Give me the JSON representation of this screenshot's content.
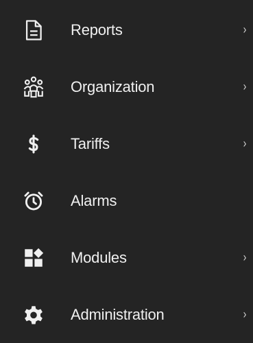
{
  "menu": {
    "items": [
      {
        "label": "Reports",
        "icon": "document-icon",
        "chevron": "›"
      },
      {
        "label": "Organization",
        "icon": "people-network-icon",
        "chevron": "›"
      },
      {
        "label": "Tariffs",
        "icon": "dollar-icon",
        "chevron": "›"
      },
      {
        "label": "Alarms",
        "icon": "alarm-clock-icon",
        "chevron": ""
      },
      {
        "label": "Modules",
        "icon": "modules-icon",
        "chevron": "›"
      },
      {
        "label": "Administration",
        "icon": "gear-icon",
        "chevron": "›"
      }
    ]
  },
  "colors": {
    "background": "#242424",
    "text": "#f0f0f0"
  }
}
